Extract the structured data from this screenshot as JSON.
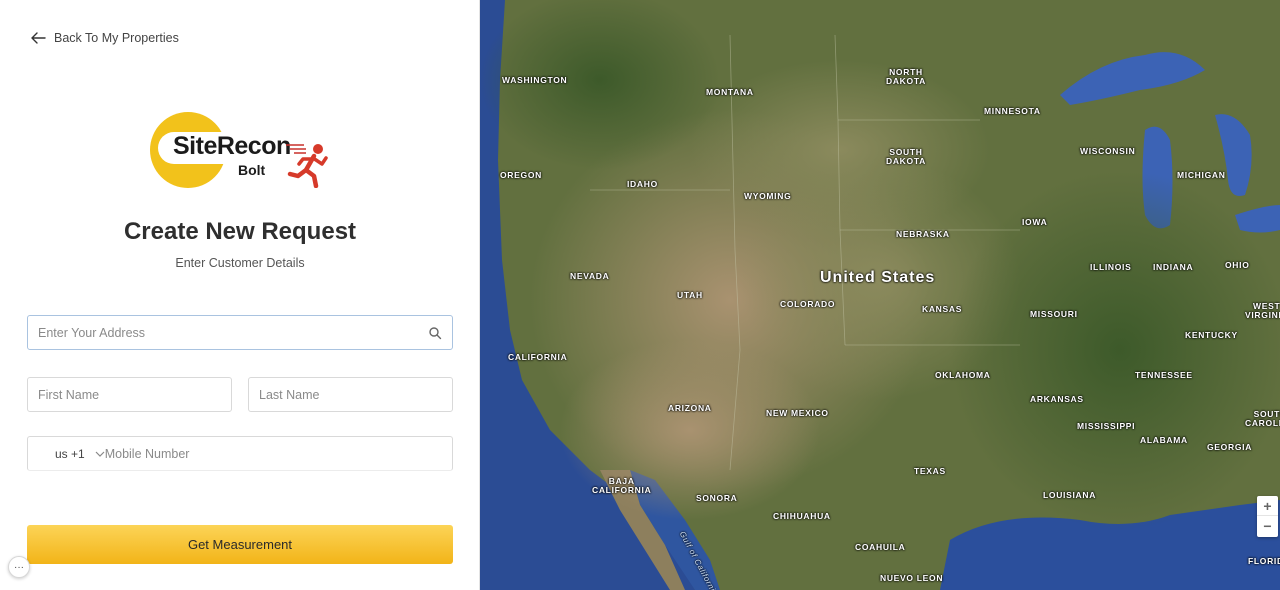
{
  "nav": {
    "back_label": "Back To My Properties"
  },
  "logo": {
    "brand": "SiteRecon",
    "product": "Bolt"
  },
  "form": {
    "title": "Create New Request",
    "subtitle": "Enter Customer Details",
    "address_placeholder": "Enter Your Address",
    "first_name_placeholder": "First Name",
    "last_name_placeholder": "Last Name",
    "country_code": "us +1",
    "phone_placeholder": "Mobile Number",
    "submit_label": "Get Measurement"
  },
  "colors": {
    "accent": "#f5bd20",
    "map_water": "#2a4f9c",
    "map_land": "#6b7a45"
  },
  "map": {
    "country_label": "United States",
    "labels": [
      {
        "text": "WASHINGTON"
      },
      {
        "text": "MONTANA"
      },
      {
        "text": "NORTH DAKOTA"
      },
      {
        "text": "MINNESOTA"
      },
      {
        "text": "OREGON"
      },
      {
        "text": "IDAHO"
      },
      {
        "text": "WYOMING"
      },
      {
        "text": "SOUTH DAKOTA"
      },
      {
        "text": "WISCONSIN"
      },
      {
        "text": "MICHIGAN"
      },
      {
        "text": "IOWA"
      },
      {
        "text": "NEBRASKA"
      },
      {
        "text": "NEVADA"
      },
      {
        "text": "ILLINOIS"
      },
      {
        "text": "INDIANA"
      },
      {
        "text": "OHIO"
      },
      {
        "text": "UTAH"
      },
      {
        "text": "COLORADO"
      },
      {
        "text": "KANSAS"
      },
      {
        "text": "MISSOURI"
      },
      {
        "text": "WEST VIRGINIA"
      },
      {
        "text": "CALIFORNIA"
      },
      {
        "text": "KENTUCKY"
      },
      {
        "text": "OKLAHOMA"
      },
      {
        "text": "TENNESSEE"
      },
      {
        "text": "ARIZONA"
      },
      {
        "text": "NEW MEXICO"
      },
      {
        "text": "ARKANSAS"
      },
      {
        "text": "MISSISSIPPI"
      },
      {
        "text": "ALABAMA"
      },
      {
        "text": "GEORGIA"
      },
      {
        "text": "SOUTH CAROLINA"
      },
      {
        "text": "TEXAS"
      },
      {
        "text": "BAJA CALIFORNIA"
      },
      {
        "text": "SONORA"
      },
      {
        "text": "CHIHUAHUA"
      },
      {
        "text": "LOUISIANA"
      },
      {
        "text": "COAHUILA"
      },
      {
        "text": "NUEVO LEON"
      },
      {
        "text": "FLORIDA"
      }
    ],
    "water_label": "Gulf of California",
    "zoom_in": "+",
    "zoom_out": "−"
  },
  "more_label": "···"
}
